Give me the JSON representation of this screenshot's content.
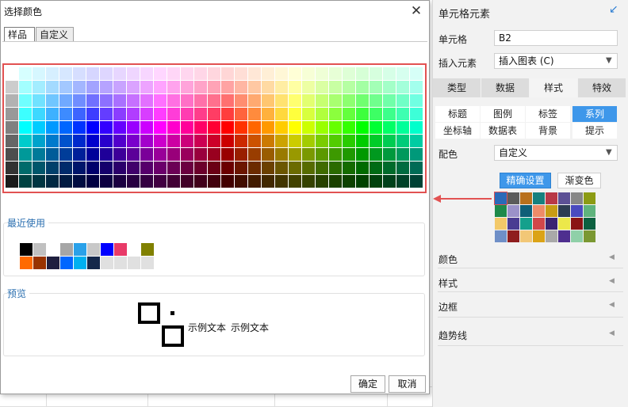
{
  "dialog": {
    "title": "选择颜色",
    "close_icon": "close-icon",
    "tabs": [
      "样品",
      "自定义"
    ],
    "recent_title": "最近使用",
    "preview_title": "预览",
    "preview_sample": "示例文本",
    "ok_label": "确定",
    "cancel_label": "取消",
    "recent_colors": [
      [
        "#000000",
        "#c0c0c0",
        "#ffffff",
        "#a6a6a6",
        "#2aa1e9",
        "#c8c8c8",
        "#0000ff",
        "#e83a68",
        "#ffffff",
        "#808000"
      ],
      [
        "#ff6a00",
        "#993300",
        "#1f1f3f",
        "#0066ff",
        "#00b0f0",
        "#14284b",
        "#e0e0e0",
        "#e0e0e0",
        "#e0e0e0",
        "#e0e0e0"
      ]
    ]
  },
  "panel": {
    "title": "单元格元素",
    "header_icon": "arrow-down-left-icon",
    "cell_label": "单元格",
    "cell_value": "B2",
    "insert_label": "插入元素",
    "insert_value": "插入图表 (C)",
    "tabs": [
      "类型",
      "数据",
      "样式",
      "特效"
    ],
    "subtabs": [
      "标题",
      "图例",
      "标签",
      "系列",
      "坐标轴",
      "数据表",
      "背景",
      "提示"
    ],
    "color_label": "配色",
    "color_value": "自定义",
    "precise_label": "精确设置",
    "gradient_label": "渐变色",
    "palette": [
      [
        "#2a6ab8",
        "#5b5b5b",
        "#b8701c",
        "#16807e",
        "#b83846",
        "#5c5095",
        "#878787",
        "#8c9b14"
      ],
      [
        "#1e8a4a",
        "#9b92c9",
        "#0f5f78",
        "#ef8b68",
        "#c79c14",
        "#2d3c52",
        "#4a4abf",
        "#5fb37d"
      ],
      [
        "#f3c969",
        "#4a3c92",
        "#14a08c",
        "#d1474a",
        "#3a2472",
        "#ece84a",
        "#8a1414",
        "#0c6040"
      ],
      [
        "#6f8fc7",
        "#8f1e1e",
        "#f2c777",
        "#dba316",
        "#a9a9a9",
        "#4e2f8f",
        "#8fd0a8",
        "#7b9832"
      ]
    ],
    "sections": [
      "颜色",
      "样式",
      "边框",
      "趋势线"
    ]
  }
}
